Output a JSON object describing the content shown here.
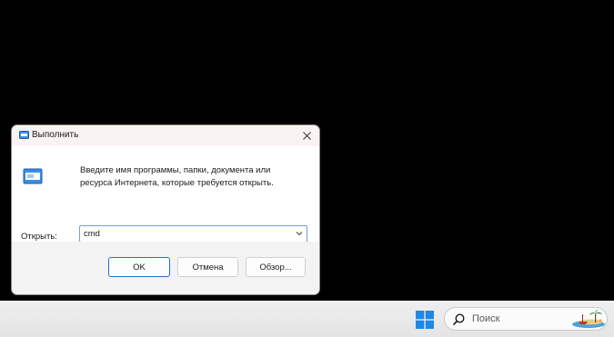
{
  "dialog": {
    "title": "Выполнить",
    "description_line1": "Введите имя программы, папки, документа или",
    "description_line2": "ресурса Интернета, которые требуется открыть.",
    "open_label": "Открыть:",
    "command_value": "cmd",
    "ok_label": "OK",
    "cancel_label": "Отмена",
    "browse_label": "Обзор..."
  },
  "taskbar": {
    "search_placeholder": "Поиск"
  },
  "colors": {
    "desktop_background": "#000000",
    "accent": "#1f6fd0",
    "start_logo": "#1e88e5"
  },
  "icons": {
    "title_icon": "run-icon",
    "close_icon": "close-icon",
    "dropdown_icon": "chevron-down-icon",
    "start_icon": "windows-logo-icon",
    "search_icon": "search-icon",
    "search_highlight": "beach-illustration-icon"
  }
}
